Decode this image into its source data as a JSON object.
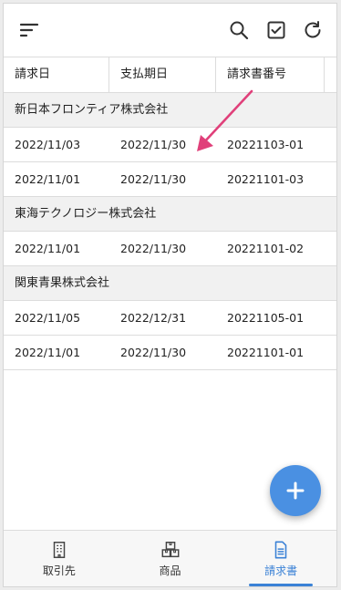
{
  "toolbar": {
    "menu_icon": "sort-menu-icon",
    "search_icon": "search-icon",
    "select_icon": "checkbox-icon",
    "refresh_icon": "refresh-icon"
  },
  "table": {
    "headers": [
      "請求日",
      "支払期日",
      "請求書番号",
      ""
    ],
    "groups": [
      {
        "name": "新日本フロンティア株式会社",
        "rows": [
          {
            "date": "2022/11/03",
            "due": "2022/11/30",
            "number": "20221103-01"
          },
          {
            "date": "2022/11/01",
            "due": "2022/11/30",
            "number": "20221101-03"
          }
        ]
      },
      {
        "name": "東海テクノロジー株式会社",
        "rows": [
          {
            "date": "2022/11/01",
            "due": "2022/11/30",
            "number": "20221101-02"
          }
        ]
      },
      {
        "name": "関東青果株式会社",
        "rows": [
          {
            "date": "2022/11/05",
            "due": "2022/12/31",
            "number": "20221105-01"
          },
          {
            "date": "2022/11/01",
            "due": "2022/11/30",
            "number": "20221101-01"
          }
        ]
      }
    ]
  },
  "fab": {
    "icon": "plus-icon"
  },
  "bottom_nav": {
    "items": [
      {
        "label": "取引先",
        "icon": "building-icon",
        "active": false
      },
      {
        "label": "商品",
        "icon": "boxes-icon",
        "active": false
      },
      {
        "label": "請求書",
        "icon": "document-icon",
        "active": true
      }
    ]
  },
  "colors": {
    "accent": "#3b82d6",
    "fab": "#4a90e2",
    "annotation_arrow": "#e0407a",
    "group_bg": "#f1f1f1"
  }
}
